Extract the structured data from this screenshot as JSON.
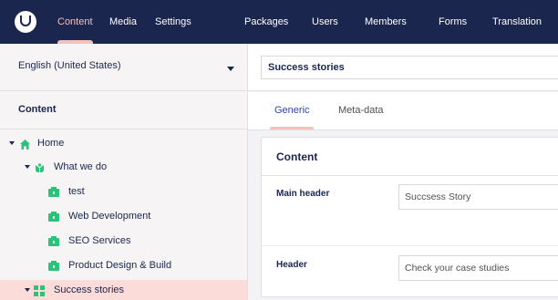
{
  "nav": {
    "items": [
      "Content",
      "Media",
      "Settings",
      "Packages",
      "Users",
      "Members",
      "Forms",
      "Translation"
    ],
    "active": "Content"
  },
  "tree": {
    "culture": "English (United States)",
    "heading": "Content",
    "nodes": [
      {
        "label": "Home",
        "icon": "home-icon",
        "expanded": true
      },
      {
        "label": "What we do",
        "icon": "hands-icon",
        "expanded": true
      },
      {
        "label": "test",
        "icon": "briefcase-icon"
      },
      {
        "label": "Web Development",
        "icon": "briefcase-icon"
      },
      {
        "label": "SEO Services",
        "icon": "briefcase-icon"
      },
      {
        "label": "Product Design & Build",
        "icon": "briefcase-icon"
      },
      {
        "label": "Success stories",
        "icon": "grid-icon",
        "expanded": true,
        "selected": true
      }
    ]
  },
  "editor": {
    "name": "Success stories",
    "tabs": [
      "Generic",
      "Meta-data"
    ],
    "active_tab": "Generic",
    "group_title": "Content",
    "properties": [
      {
        "label": "Main header",
        "value": "Succsess Story"
      },
      {
        "label": "Header",
        "value": "Check your case studies"
      }
    ]
  },
  "colors": {
    "header_bg": "#1b264f",
    "accent": "#f5c1bc",
    "icon_green": "#2bc37c",
    "selected_bg": "#fbdcd8",
    "active_tab": "#3544b1"
  }
}
